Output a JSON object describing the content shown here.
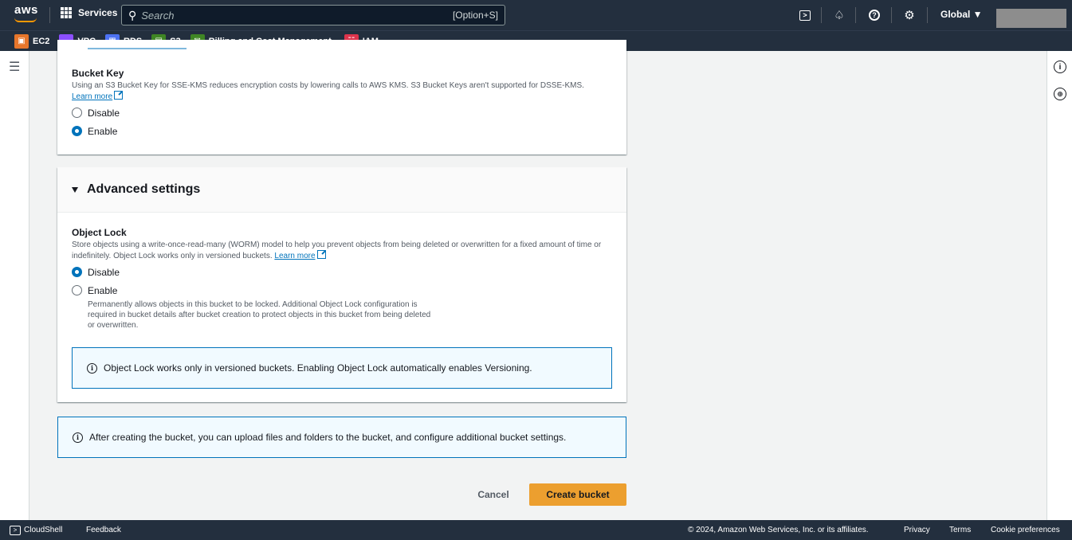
{
  "topbar": {
    "logo_text": "aws",
    "services_label": "Services",
    "search_placeholder": "Search",
    "search_shortcut": "[Option+S]",
    "region_label": "Global ▼",
    "icons": [
      "cloudshell-icon",
      "bell-icon",
      "help-icon",
      "gear-icon"
    ]
  },
  "favorites": [
    {
      "label": "EC2",
      "color": "#e7762b",
      "icon": "ec2-icon"
    },
    {
      "label": "VPC",
      "color": "#8c4fff",
      "icon": "vpc-icon"
    },
    {
      "label": "RDS",
      "color": "#4d72f3",
      "icon": "rds-icon"
    },
    {
      "label": "S3",
      "color": "#3f8624",
      "icon": "s3-icon"
    },
    {
      "label": "Billing and Cost Management",
      "color": "#3f8624",
      "icon": "billing-icon"
    },
    {
      "label": "IAM",
      "color": "#dd344c",
      "icon": "iam-icon"
    }
  ],
  "bucket_key": {
    "label": "Bucket Key",
    "description": "Using an S3 Bucket Key for SSE-KMS reduces encryption costs by lowering calls to AWS KMS. S3 Bucket Keys aren't supported for DSSE-KMS.",
    "learn_more": "Learn more",
    "options": [
      {
        "label": "Disable",
        "checked": false
      },
      {
        "label": "Enable",
        "checked": true
      }
    ]
  },
  "advanced": {
    "title": "Advanced settings",
    "object_lock": {
      "label": "Object Lock",
      "description": "Store objects using a write-once-read-many (WORM) model to help you prevent objects from being deleted or overwritten for a fixed amount of time or indefinitely. Object Lock works only in versioned buckets.",
      "learn_more": "Learn more",
      "option_disable": "Disable",
      "option_enable": "Enable",
      "enable_desc_1": "Permanently allows objects in this bucket to be locked. Additional Object Lock configuration is",
      "enable_desc_2": "required in bucket details after bucket creation to protect objects in this bucket from being deleted",
      "enable_desc_3": "or overwritten.",
      "selected": "Disable"
    },
    "alert": "Object Lock works only in versioned buckets. Enabling Object Lock automatically enables Versioning."
  },
  "info_alert": "After creating the bucket, you can upload files and folders to the bucket, and configure additional bucket settings.",
  "actions": {
    "cancel": "Cancel",
    "create": "Create bucket"
  },
  "footer": {
    "cloudshell": "CloudShell",
    "feedback": "Feedback",
    "copyright": "© 2024, Amazon Web Services, Inc. or its affiliates.",
    "privacy": "Privacy",
    "terms": "Terms",
    "cookies": "Cookie preferences"
  },
  "colors": {
    "nav_bg": "#232f3e",
    "primary_button": "#ec9f2f",
    "link": "#0073bb",
    "alert_border": "#0073bb"
  }
}
